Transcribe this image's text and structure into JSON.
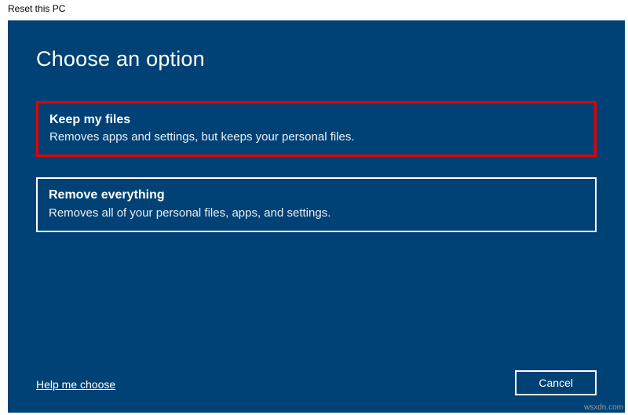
{
  "window": {
    "title": "Reset this PC"
  },
  "dialog": {
    "heading": "Choose an option",
    "options": [
      {
        "title": "Keep my files",
        "description": "Removes apps and settings, but keeps your personal files.",
        "highlighted": true
      },
      {
        "title": "Remove everything",
        "description": "Removes all of your personal files, apps, and settings.",
        "highlighted": false
      }
    ],
    "help_link": "Help me choose",
    "cancel_label": "Cancel"
  },
  "watermark": "wsxdn.com"
}
